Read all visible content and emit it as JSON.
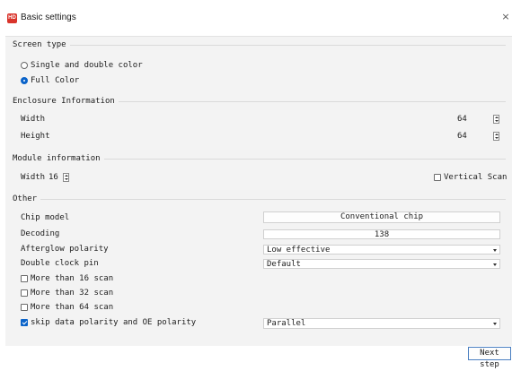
{
  "window": {
    "title": "Basic settings",
    "icon": "app-logo-icon",
    "icon_text": "HD",
    "close_label": "×"
  },
  "screen_type": {
    "legend": "Screen type",
    "options": [
      {
        "label": "Single and double color",
        "checked": false
      },
      {
        "label": "Full Color",
        "checked": true
      }
    ]
  },
  "enclosure": {
    "legend": "Enclosure Information",
    "width_label": "Width",
    "width_value": "64",
    "height_label": "Height",
    "height_value": "64"
  },
  "module": {
    "legend": "Module information",
    "width_label": "Width",
    "width_value": "16",
    "vertical_scan_label": "Vertical Scan",
    "vertical_scan_checked": false
  },
  "other": {
    "legend": "Other",
    "chip_model_label": "Chip model",
    "chip_model_value": "Conventional chip",
    "decoding_label": "Decoding",
    "decoding_value": "138",
    "afterglow_label": "Afterglow polarity",
    "afterglow_value": "Low effective",
    "double_clock_label": "Double clock pin",
    "double_clock_value": "Default",
    "more16_label": "More than 16 scan",
    "more16_checked": false,
    "more32_label": "More than 32 scan",
    "more32_checked": false,
    "more64_label": "More than 64 scan",
    "more64_checked": false,
    "skip_label": "skip data polarity and OE polarity",
    "skip_checked": true,
    "skip_value": "Parallel"
  },
  "footer": {
    "next_label": "Next step"
  },
  "colors": {
    "accent": "#0a63c9",
    "logo": "#d9342b"
  }
}
